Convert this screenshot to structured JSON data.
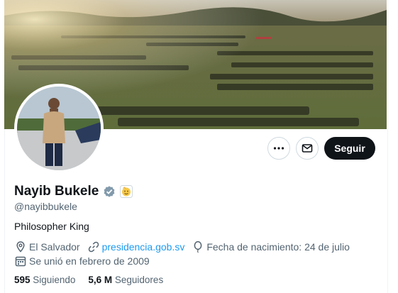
{
  "profile": {
    "name": "Nayib Bukele",
    "handle": "@nayibbukele",
    "bio": "Philosopher King",
    "verified_icon": "verified-badge-icon",
    "affiliate_icon": "emoji-badge-icon"
  },
  "actions": {
    "more_icon": "more-horizontal-icon",
    "message_icon": "envelope-icon",
    "follow_label": "Seguir"
  },
  "meta": {
    "location": "El Salvador",
    "website": "presidencia.gob.sv",
    "birthday": "Fecha de nacimiento: 24 de julio",
    "joined": "Se unió en febrero de 2009"
  },
  "stats": {
    "following_count": "595",
    "following_label": "Siguiendo",
    "followers_count": "5,6 M",
    "followers_label": "Seguidores"
  },
  "colors": {
    "accent": "#1d9bf0",
    "follow_button": "#0f1419",
    "secondary_text": "#536471",
    "verified": "#829aab"
  }
}
